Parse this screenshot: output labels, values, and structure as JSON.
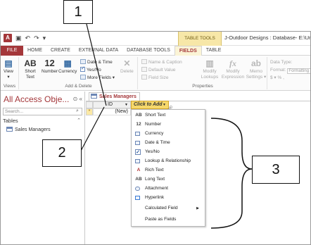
{
  "quick_access": {
    "app_letter": "A",
    "save_icon": "save-icon",
    "undo_icon": "undo-icon",
    "redo_icon": "redo-icon"
  },
  "context_tab_group": "TABLE TOOLS",
  "window_title": "J-Outdoor Designs : Database- E:\\Unit",
  "ribbon_tabs": [
    "FILE",
    "HOME",
    "CREATE",
    "EXTERNAL DATA",
    "DATABASE TOOLS",
    "FIELDS",
    "TABLE"
  ],
  "active_tab": "FIELDS",
  "ribbon": {
    "views": {
      "view_label": "View",
      "group_label": "Views"
    },
    "add_delete": {
      "short_text": "Short Text",
      "number": "Number",
      "currency": "Currency",
      "date_time": "Date & Time",
      "yes_no": "Yes/No",
      "more_fields": "More Fields",
      "delete": "Delete",
      "group_label": "Add & Delete",
      "ab_glyph": "AB",
      "num_glyph": "12"
    },
    "properties": {
      "name_caption": "Name & Caption",
      "default_value": "Default Value",
      "field_size": "Field Size",
      "modify_lookups": "Modify Lookups",
      "modify_expression": "Modify Expression",
      "memo_settings": "Memo Settings",
      "group_label": "Properties"
    },
    "formatting": {
      "data_type": "Data Type:",
      "format": "Format:",
      "format_value": "Formatting",
      "currency_symbol": "$",
      "percent_symbol": "%",
      "comma_symbol": ","
    }
  },
  "nav_pane": {
    "title": "All Access Obje...",
    "search_placeholder": "Search...",
    "section": "Tables",
    "items": [
      "Sales Managers"
    ]
  },
  "document": {
    "tab_label": "Sales Managers",
    "columns": [
      "ID",
      "Click to Add"
    ],
    "new_row_marker": "*",
    "new_row_value": "(New)"
  },
  "dropdown_items": [
    {
      "icon": "AB",
      "label": "Short Text"
    },
    {
      "icon": "12",
      "label": "Number"
    },
    {
      "icon": "box",
      "label": "Currency"
    },
    {
      "icon": "box",
      "label": "Date & Time"
    },
    {
      "icon": "check",
      "label": "Yes/No"
    },
    {
      "icon": "box",
      "label": "Lookup & Relationship"
    },
    {
      "icon": "A",
      "label": "Rich Text"
    },
    {
      "icon": "AB",
      "label": "Long Text"
    },
    {
      "icon": "box",
      "label": "Attachment"
    },
    {
      "icon": "box",
      "label": "Hyperlink"
    },
    {
      "icon": "",
      "label": "Calculated Field",
      "submenu": true
    },
    {
      "icon": "",
      "label": "Paste as Fields"
    }
  ],
  "callouts": [
    "1",
    "2",
    "3"
  ]
}
